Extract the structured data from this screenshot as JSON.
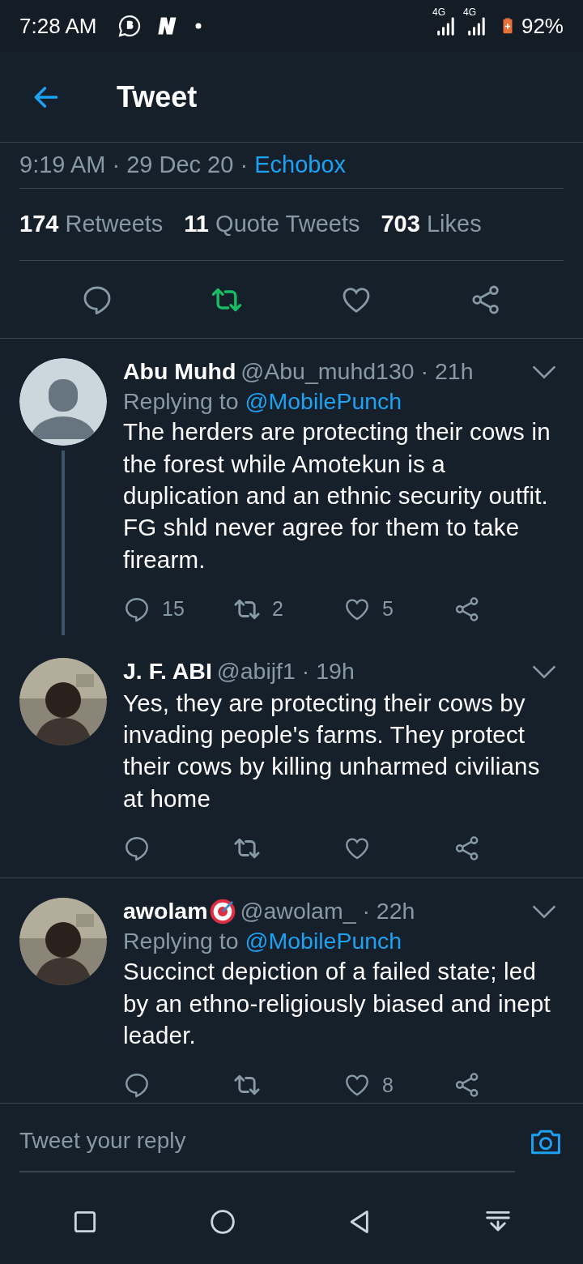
{
  "status_bar": {
    "time": "7:28 AM",
    "network_1": "4G",
    "network_2": "4G",
    "battery": "92%"
  },
  "header": {
    "title": "Tweet"
  },
  "tweet": {
    "time": "9:19 AM · 29 Dec 20 · ",
    "source": "Echobox",
    "stats": [
      {
        "count": "174",
        "label": "Retweets"
      },
      {
        "count": "11",
        "label": "Quote Tweets"
      },
      {
        "count": "703",
        "label": "Likes"
      }
    ],
    "retweeted": true,
    "liked": false
  },
  "replies": [
    {
      "avatar": {
        "kind": "default"
      },
      "name": "Abu Muhd",
      "name_icon": false,
      "handle": "@Abu_muhd130 · 21h",
      "replying_label": "Replying to",
      "replying_to": "@MobilePunch",
      "text": "The herders are protecting their cows in the forest while Amotekun is a duplication and an ethnic security outfit. FG shld never agree for them to take firearm.",
      "reply_count": "15",
      "retweet_count": "2",
      "like_count": "5",
      "retweeted": false,
      "liked": false,
      "thread_below": true
    },
    {
      "name": "J. F. ABI",
      "name_icon": false,
      "handle": "@abijf1 · 19h",
      "text": "Yes, they are protecting their cows by invading people's farms. They protect their cows by killing unharmed civilians at home",
      "retweeted": false,
      "liked": false,
      "thread_below": false
    },
    {
      "name": "awolam",
      "name_icon": true,
      "handle": "@awolam_ · 22h",
      "replying_label": "Replying to",
      "replying_to": "@MobilePunch",
      "text": "Succinct depiction of a failed state; led by an ethno-religiously biased and inept leader.",
      "like_count": "8",
      "retweeted": false,
      "liked": false,
      "thread_below": false
    }
  ],
  "reply_bar": {
    "placeholder": "Tweet your reply"
  }
}
